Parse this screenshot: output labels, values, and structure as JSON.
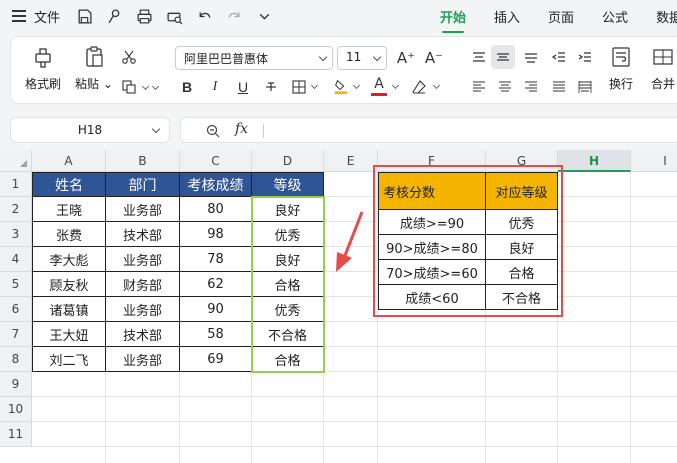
{
  "menubar": {
    "file_label": "文件",
    "tabs": [
      {
        "label": "开始",
        "active": true
      },
      {
        "label": "插入",
        "active": false
      },
      {
        "label": "页面",
        "active": false
      },
      {
        "label": "公式",
        "active": false
      },
      {
        "label": "数据",
        "active": false
      }
    ]
  },
  "ribbon": {
    "format_painter": "格式刷",
    "paste": "粘贴",
    "font_name": "阿里巴巴普惠体",
    "font_size": "11",
    "bold": "B",
    "italic": "I",
    "underline": "U",
    "wrap": "换行",
    "merge": "合并",
    "font_color_accent": "#e02020",
    "fill_color_accent": "#f4b400"
  },
  "formula_bar": {
    "cell_ref": "H18",
    "fx_label": "fx",
    "value": ""
  },
  "sheet": {
    "columns": [
      "A",
      "B",
      "C",
      "D",
      "E",
      "F",
      "G",
      "H",
      "I"
    ],
    "selected_column": "H",
    "rows": [
      "1",
      "2",
      "3",
      "4",
      "5",
      "6",
      "7",
      "8",
      "9",
      "10",
      "11"
    ],
    "table1": {
      "headers": [
        "姓名",
        "部门",
        "考核成绩",
        "等级"
      ],
      "rows": [
        [
          "王晓",
          "业务部",
          "80",
          "良好"
        ],
        [
          "张费",
          "技术部",
          "98",
          "优秀"
        ],
        [
          "李大彪",
          "业务部",
          "78",
          "良好"
        ],
        [
          "顾友秋",
          "财务部",
          "62",
          "合格"
        ],
        [
          "诸葛镇",
          "业务部",
          "90",
          "优秀"
        ],
        [
          "王大妞",
          "技术部",
          "58",
          "不合格"
        ],
        [
          "刘二飞",
          "业务部",
          "69",
          "合格"
        ]
      ]
    },
    "table2": {
      "headers": [
        "考核分数",
        "对应等级"
      ],
      "rows": [
        [
          "成绩>=90",
          "优秀"
        ],
        [
          "90>成绩>=80",
          "良好"
        ],
        [
          "70>成绩>=60",
          "合格"
        ],
        [
          "成绩<60",
          "不合格"
        ]
      ]
    },
    "colors": {
      "header_blue": "#2f5597",
      "header_yellow": "#f4b400",
      "highlight_green": "#92d050",
      "highlight_red": "#e74c4c",
      "accent_green": "#1f9f56"
    }
  }
}
